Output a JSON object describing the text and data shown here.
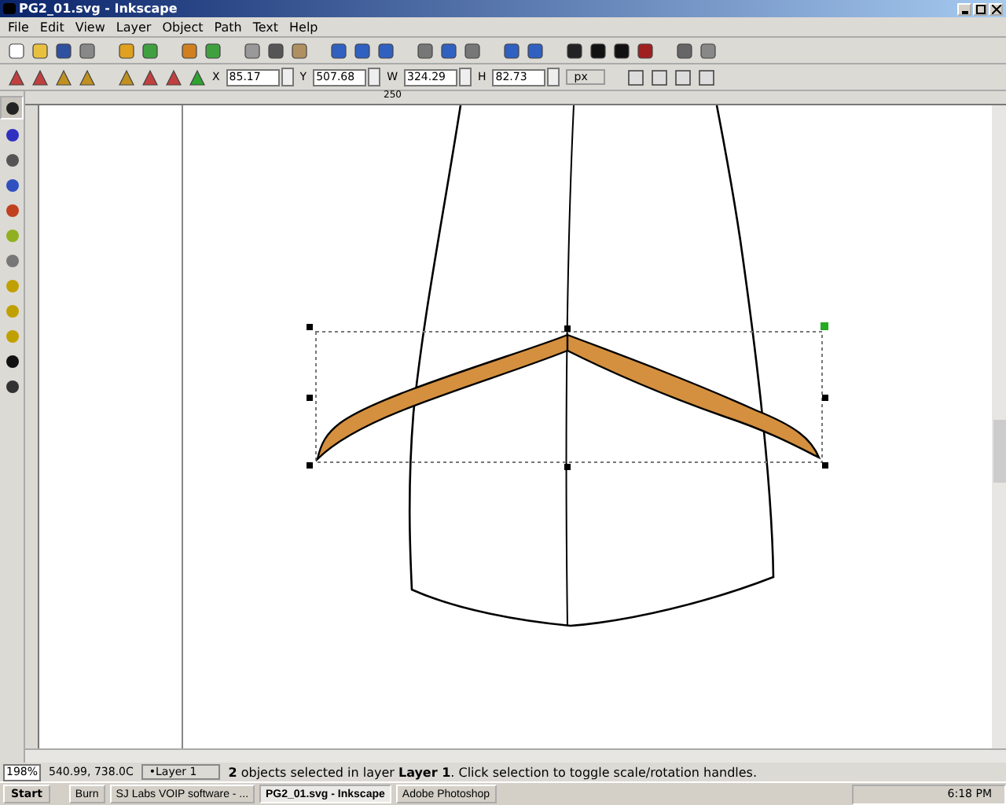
{
  "window": {
    "title": "PG2_01.svg - Inkscape"
  },
  "menu": [
    {
      "label": "File"
    },
    {
      "label": "Edit"
    },
    {
      "label": "View"
    },
    {
      "label": "Layer"
    },
    {
      "label": "Object"
    },
    {
      "label": "Path"
    },
    {
      "label": "Text"
    },
    {
      "label": "Help"
    }
  ],
  "tool_controls": {
    "fields": [
      {
        "label": "X",
        "value": "85.17"
      },
      {
        "label": "Y",
        "value": "507.68"
      },
      {
        "label": "W",
        "value": "324.29"
      },
      {
        "label": "H",
        "value": "82.73"
      }
    ],
    "unit": "px"
  },
  "ruler": {
    "labels": [
      "250"
    ]
  },
  "tools": [
    {
      "selected": true
    },
    {
      "selected": false
    },
    {
      "selected": false
    },
    {
      "selected": false
    },
    {
      "selected": false
    },
    {
      "selected": false
    },
    {
      "selected": false
    },
    {
      "selected": false
    },
    {
      "selected": false
    },
    {
      "selected": false
    },
    {
      "selected": false
    },
    {
      "selected": false
    }
  ],
  "status_bar": {
    "zoom": "198%",
    "coordinates": "540.99, 738.0C",
    "layer": "•Layer 1",
    "message": "**2** objects selected in layer **Layer 1**. Click selection to toggle scale/rotation handles."
  },
  "taskbar": {
    "start": "Start",
    "tasks": [
      {
        "label": "Burn",
        "selected": false
      },
      {
        "label": "SJ Labs VOIP software - ...",
        "selected": false
      },
      {
        "label": "PG2_01.svg - Inkscape",
        "selected": true
      },
      {
        "label": "Adobe Photoshop",
        "selected": false
      }
    ],
    "clock": "6:18 PM"
  }
}
